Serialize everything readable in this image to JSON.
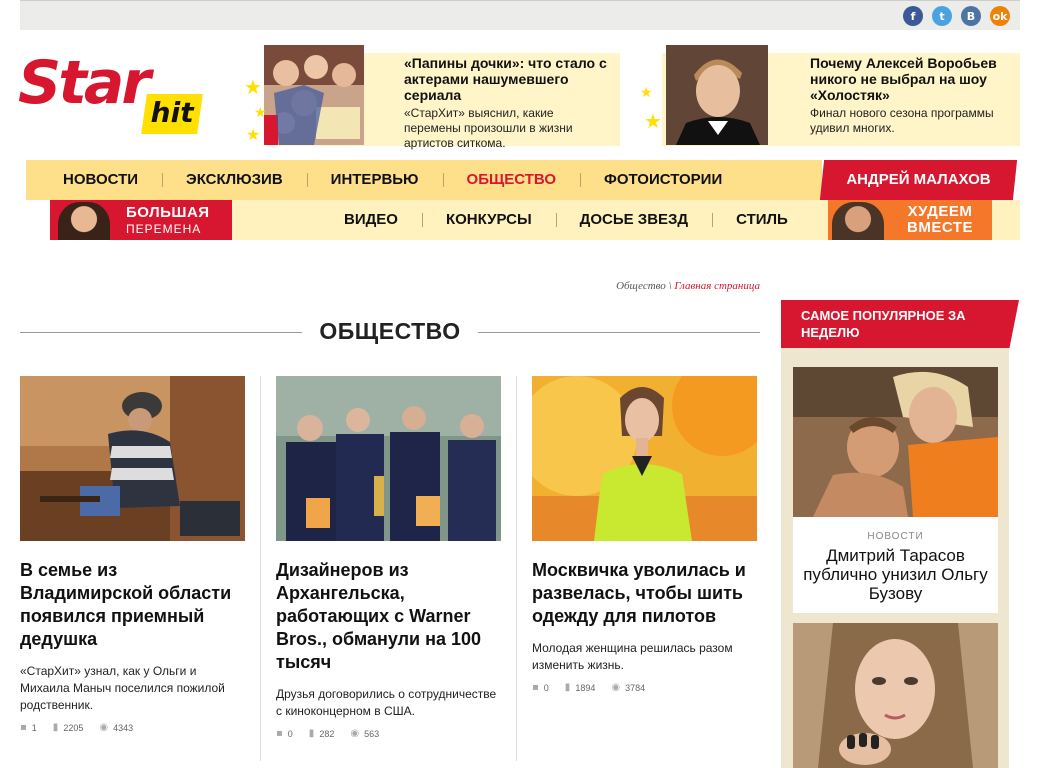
{
  "social": {
    "facebook": "f",
    "twitter": "t",
    "vk": "B",
    "odnoklassniki": "ok"
  },
  "logo": {
    "star": "Star",
    "hit": "hit"
  },
  "promos": [
    {
      "title": "«Папины дочки»: что стало с актерами нашумевшего сериала",
      "subtitle": "«СтарХит» выяснил, какие перемены произошли в жизни артистов ситкома."
    },
    {
      "title": "Почему Алексей Воробьев никого не выбрал на шоу «Холостяк»",
      "subtitle": "Финал нового сезона программы удивил многих."
    }
  ],
  "nav_primary": [
    "НОВОСТИ",
    "ЭКСКЛЮЗИВ",
    "ИНТЕРВЬЮ",
    "ОБЩЕСТВО",
    "ФОТОИСТОРИИ"
  ],
  "nav_special": "АНДРЕЙ МАЛАХОВ",
  "nav_secondary": [
    "ВИДЕО",
    "КОНКУРСЫ",
    "ДОСЬЕ ЗВЕЗД",
    "СТИЛЬ"
  ],
  "banner_left": {
    "line1": "БОЛЬШАЯ",
    "line2": "ПЕРЕМЕНА"
  },
  "banner_right": {
    "text": "ХУДЕЕМ ВМЕСТЕ"
  },
  "breadcrumb": {
    "current": "Общество",
    "separator": "\\",
    "home": "Главная страница"
  },
  "section_title": "ОБЩЕСТВО",
  "articles": [
    {
      "title": "В семье из Владимирской области появился приемный дедушка",
      "lead": "«СтарХит» узнал, как у Ольги и Михаила Маныч поселился пожилой родственник.",
      "comments": "1",
      "stats": "2205",
      "views": "4343"
    },
    {
      "title": "Дизайнеров из Архангельска, работающих с Warner Bros., обманули на 100 тысяч",
      "lead": "Друзья договорились о сотрудничестве с киноконцерном в США.",
      "comments": "0",
      "stats": "282",
      "views": "563"
    },
    {
      "title": "Москвичка уволилась и развелась, чтобы шить одежду для пилотов",
      "lead": "Молодая женщина решилась разом изменить жизнь.",
      "comments": "0",
      "stats": "1894",
      "views": "3784"
    }
  ],
  "sidebar": {
    "header": "САМОЕ ПОПУЛЯРНОЕ ЗА НЕДЕЛЮ",
    "card1": {
      "category": "НОВОСТИ",
      "title": "Дмитрий Тарасов публично унизил Ольгу Бузову"
    }
  },
  "colors": {
    "brand_red": "#d7172f",
    "nav_yellow": "#ffe08a",
    "brand_yellow": "#ffe000",
    "orange": "#f5772a"
  }
}
